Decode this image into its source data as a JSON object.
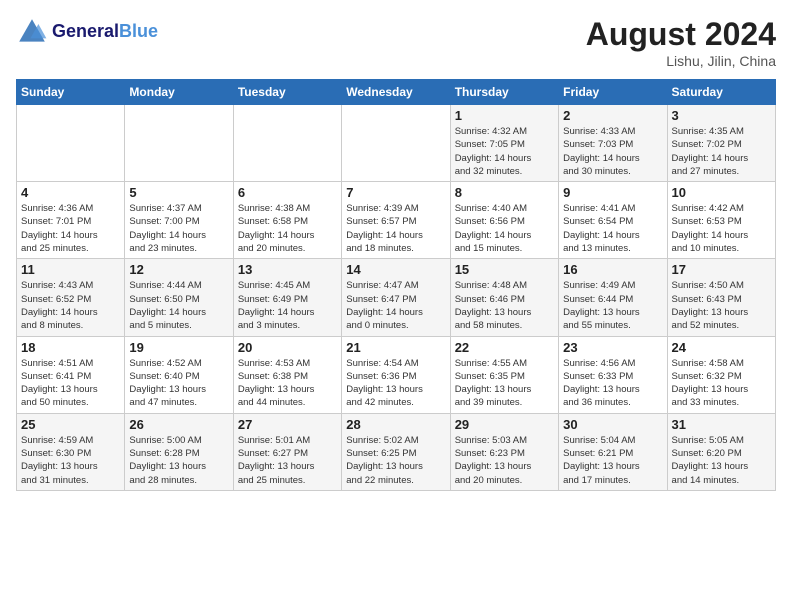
{
  "header": {
    "logo_line1": "General",
    "logo_line2": "Blue",
    "month_year": "August 2024",
    "location": "Lishu, Jilin, China"
  },
  "weekdays": [
    "Sunday",
    "Monday",
    "Tuesday",
    "Wednesday",
    "Thursday",
    "Friday",
    "Saturday"
  ],
  "weeks": [
    [
      {
        "day": "",
        "info": ""
      },
      {
        "day": "",
        "info": ""
      },
      {
        "day": "",
        "info": ""
      },
      {
        "day": "",
        "info": ""
      },
      {
        "day": "1",
        "info": "Sunrise: 4:32 AM\nSunset: 7:05 PM\nDaylight: 14 hours\nand 32 minutes."
      },
      {
        "day": "2",
        "info": "Sunrise: 4:33 AM\nSunset: 7:03 PM\nDaylight: 14 hours\nand 30 minutes."
      },
      {
        "day": "3",
        "info": "Sunrise: 4:35 AM\nSunset: 7:02 PM\nDaylight: 14 hours\nand 27 minutes."
      }
    ],
    [
      {
        "day": "4",
        "info": "Sunrise: 4:36 AM\nSunset: 7:01 PM\nDaylight: 14 hours\nand 25 minutes."
      },
      {
        "day": "5",
        "info": "Sunrise: 4:37 AM\nSunset: 7:00 PM\nDaylight: 14 hours\nand 23 minutes."
      },
      {
        "day": "6",
        "info": "Sunrise: 4:38 AM\nSunset: 6:58 PM\nDaylight: 14 hours\nand 20 minutes."
      },
      {
        "day": "7",
        "info": "Sunrise: 4:39 AM\nSunset: 6:57 PM\nDaylight: 14 hours\nand 18 minutes."
      },
      {
        "day": "8",
        "info": "Sunrise: 4:40 AM\nSunset: 6:56 PM\nDaylight: 14 hours\nand 15 minutes."
      },
      {
        "day": "9",
        "info": "Sunrise: 4:41 AM\nSunset: 6:54 PM\nDaylight: 14 hours\nand 13 minutes."
      },
      {
        "day": "10",
        "info": "Sunrise: 4:42 AM\nSunset: 6:53 PM\nDaylight: 14 hours\nand 10 minutes."
      }
    ],
    [
      {
        "day": "11",
        "info": "Sunrise: 4:43 AM\nSunset: 6:52 PM\nDaylight: 14 hours\nand 8 minutes."
      },
      {
        "day": "12",
        "info": "Sunrise: 4:44 AM\nSunset: 6:50 PM\nDaylight: 14 hours\nand 5 minutes."
      },
      {
        "day": "13",
        "info": "Sunrise: 4:45 AM\nSunset: 6:49 PM\nDaylight: 14 hours\nand 3 minutes."
      },
      {
        "day": "14",
        "info": "Sunrise: 4:47 AM\nSunset: 6:47 PM\nDaylight: 14 hours\nand 0 minutes."
      },
      {
        "day": "15",
        "info": "Sunrise: 4:48 AM\nSunset: 6:46 PM\nDaylight: 13 hours\nand 58 minutes."
      },
      {
        "day": "16",
        "info": "Sunrise: 4:49 AM\nSunset: 6:44 PM\nDaylight: 13 hours\nand 55 minutes."
      },
      {
        "day": "17",
        "info": "Sunrise: 4:50 AM\nSunset: 6:43 PM\nDaylight: 13 hours\nand 52 minutes."
      }
    ],
    [
      {
        "day": "18",
        "info": "Sunrise: 4:51 AM\nSunset: 6:41 PM\nDaylight: 13 hours\nand 50 minutes."
      },
      {
        "day": "19",
        "info": "Sunrise: 4:52 AM\nSunset: 6:40 PM\nDaylight: 13 hours\nand 47 minutes."
      },
      {
        "day": "20",
        "info": "Sunrise: 4:53 AM\nSunset: 6:38 PM\nDaylight: 13 hours\nand 44 minutes."
      },
      {
        "day": "21",
        "info": "Sunrise: 4:54 AM\nSunset: 6:36 PM\nDaylight: 13 hours\nand 42 minutes."
      },
      {
        "day": "22",
        "info": "Sunrise: 4:55 AM\nSunset: 6:35 PM\nDaylight: 13 hours\nand 39 minutes."
      },
      {
        "day": "23",
        "info": "Sunrise: 4:56 AM\nSunset: 6:33 PM\nDaylight: 13 hours\nand 36 minutes."
      },
      {
        "day": "24",
        "info": "Sunrise: 4:58 AM\nSunset: 6:32 PM\nDaylight: 13 hours\nand 33 minutes."
      }
    ],
    [
      {
        "day": "25",
        "info": "Sunrise: 4:59 AM\nSunset: 6:30 PM\nDaylight: 13 hours\nand 31 minutes."
      },
      {
        "day": "26",
        "info": "Sunrise: 5:00 AM\nSunset: 6:28 PM\nDaylight: 13 hours\nand 28 minutes."
      },
      {
        "day": "27",
        "info": "Sunrise: 5:01 AM\nSunset: 6:27 PM\nDaylight: 13 hours\nand 25 minutes."
      },
      {
        "day": "28",
        "info": "Sunrise: 5:02 AM\nSunset: 6:25 PM\nDaylight: 13 hours\nand 22 minutes."
      },
      {
        "day": "29",
        "info": "Sunrise: 5:03 AM\nSunset: 6:23 PM\nDaylight: 13 hours\nand 20 minutes."
      },
      {
        "day": "30",
        "info": "Sunrise: 5:04 AM\nSunset: 6:21 PM\nDaylight: 13 hours\nand 17 minutes."
      },
      {
        "day": "31",
        "info": "Sunrise: 5:05 AM\nSunset: 6:20 PM\nDaylight: 13 hours\nand 14 minutes."
      }
    ]
  ]
}
